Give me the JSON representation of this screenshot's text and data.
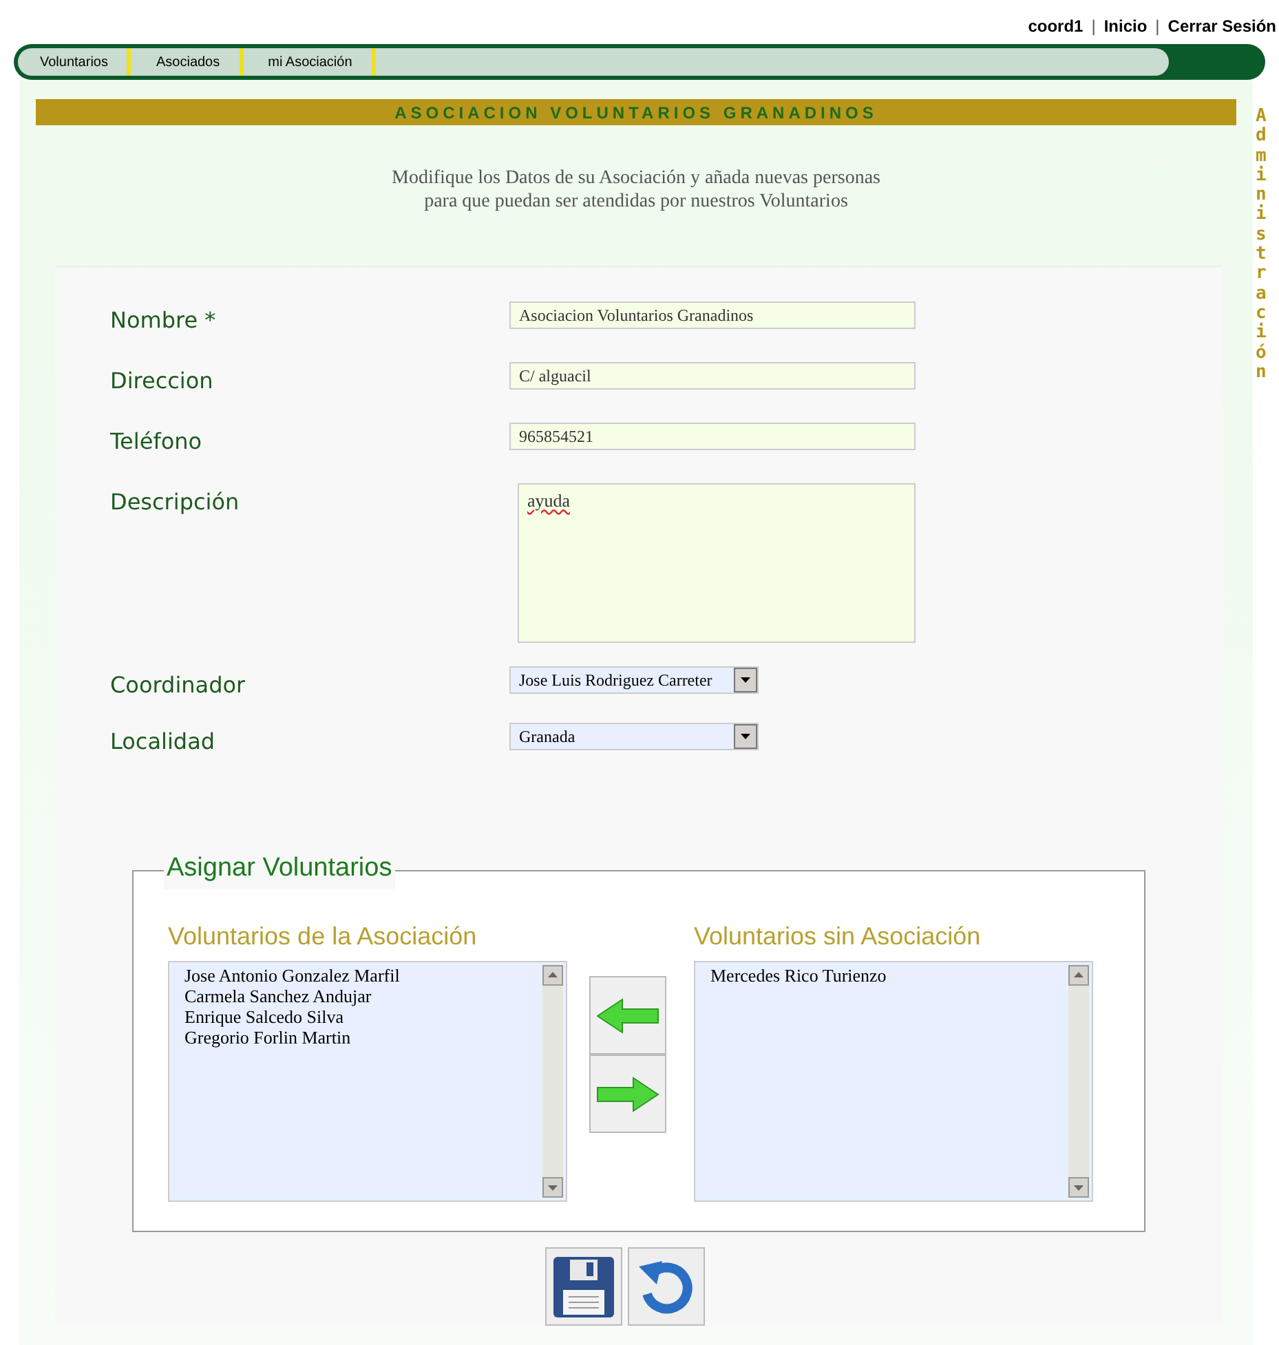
{
  "user_links": [
    {
      "kind": "link",
      "text": "coord1"
    },
    {
      "kind": "separator",
      "text": "|"
    },
    {
      "kind": "link",
      "text": "Inicio"
    },
    {
      "kind": "separator",
      "text": "|"
    },
    {
      "kind": "link",
      "text": "Cerrar Sesión"
    }
  ],
  "nav_tabs": [
    {
      "label": "Voluntarios"
    },
    {
      "label": "Asociados"
    },
    {
      "label": "mi Asociación"
    }
  ],
  "page_title": "ASOCIACION VOLUNTARIOS GRANADINOS",
  "side_label": "Administración",
  "intro": [
    "Modifique los Datos de su Asociación y añada nuevas personas",
    "para que puedan ser atendidas por nuestros Voluntarios"
  ],
  "fields": [
    {
      "kind": "text",
      "label": "Nombre *",
      "value": "Asociacion Voluntarios Granadinos"
    },
    {
      "kind": "text",
      "label": "Direccion",
      "value": "C/ alguacil"
    },
    {
      "kind": "text",
      "label": "Teléfono",
      "value": "965854521"
    },
    {
      "kind": "textarea",
      "label": "Descripción",
      "value": "ayuda"
    },
    {
      "kind": "select",
      "label": "Coordinador",
      "value": "Jose Luis Rodriguez Carreter"
    },
    {
      "kind": "select",
      "label": "Localidad",
      "value": "Granada"
    }
  ],
  "assign": {
    "legend": "Asignar Voluntarios",
    "left_list": {
      "title": "Voluntarios de la Asociación",
      "items": [
        "Jose Antonio Gonzalez Marfil",
        "Carmela Sanchez Andujar",
        "Enrique Salcedo Silva",
        "Gregorio Forlin Martin"
      ]
    },
    "right_list": {
      "title": "Voluntarios sin Asociación",
      "items": [
        "Mercedes Rico Turienzo"
      ]
    }
  }
}
